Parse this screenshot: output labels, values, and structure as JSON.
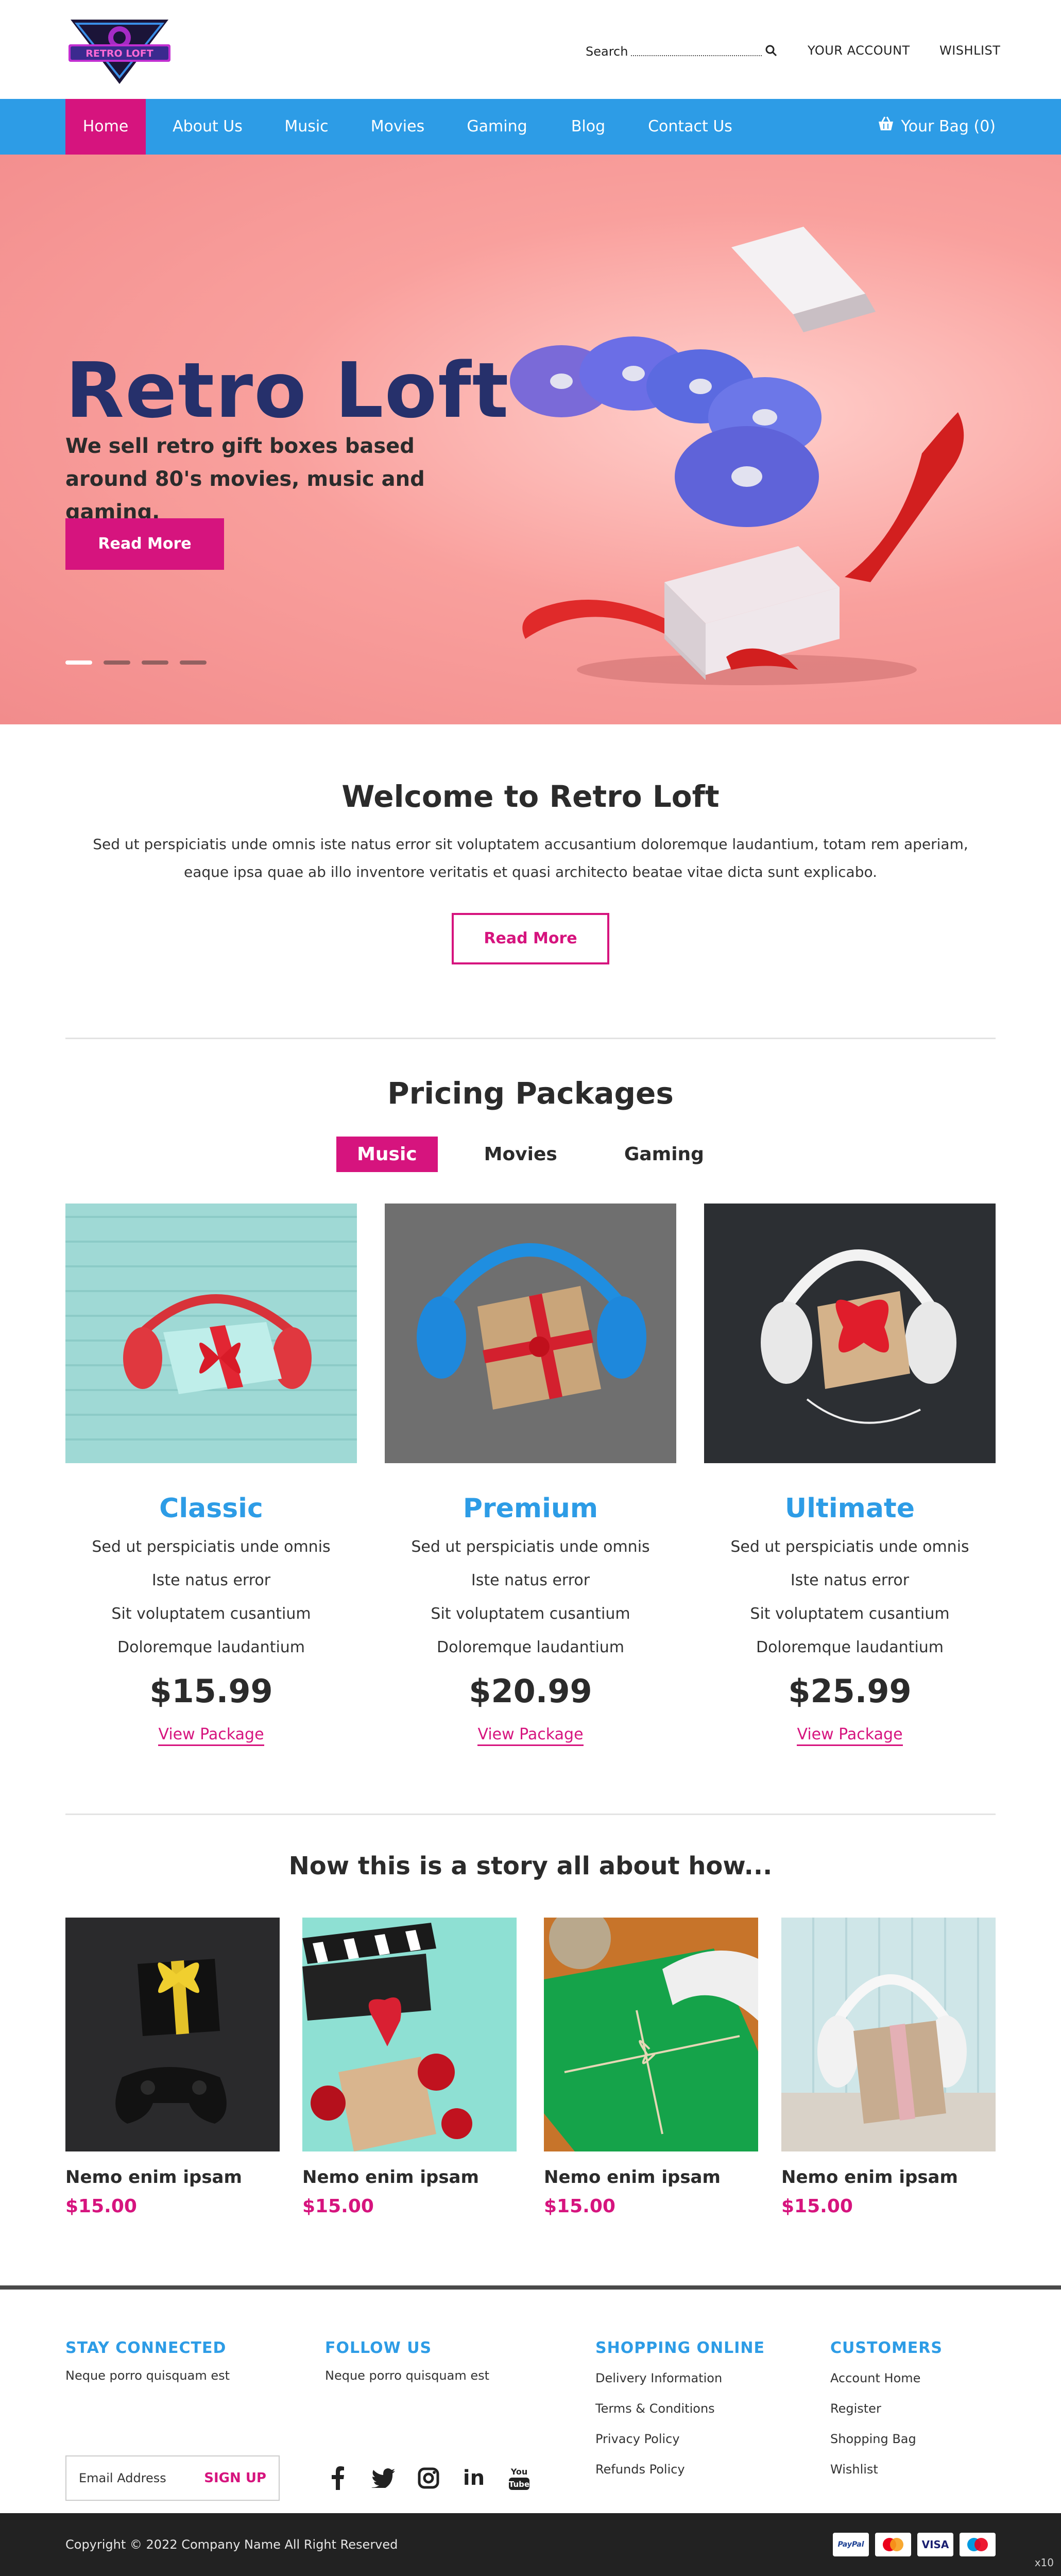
{
  "header": {
    "logo_text": "RETRO LOFT",
    "search_label": "Search",
    "account_label": "YOUR ACCOUNT",
    "wishlist_label": "WISHLIST"
  },
  "nav": {
    "items": [
      {
        "label": "Home",
        "active": true
      },
      {
        "label": "About Us"
      },
      {
        "label": "Music"
      },
      {
        "label": "Movies"
      },
      {
        "label": "Gaming"
      },
      {
        "label": "Blog"
      },
      {
        "label": "Contact Us"
      }
    ],
    "bag_label": "Your Bag (0)"
  },
  "hero": {
    "title": "Retro Loft",
    "subtitle": "We sell retro gift boxes based around 80's movies, music and gaming.",
    "button": "Read More",
    "slides": 4,
    "active_slide": 1
  },
  "welcome": {
    "title": "Welcome to Retro Loft",
    "text": "Sed ut perspiciatis unde omnis iste natus error sit voluptatem accusantium doloremque laudantium, totam rem aperiam, eaque ipsa quae ab illo inventore veritatis et quasi architecto beatae vitae dicta sunt explicabo.",
    "button": "Read More"
  },
  "pricing": {
    "title": "Pricing Packages",
    "tabs": [
      {
        "label": "Music",
        "active": true
      },
      {
        "label": "Movies"
      },
      {
        "label": "Gaming"
      }
    ],
    "packages": [
      {
        "name": "Classic",
        "lines": [
          "Sed ut perspiciatis unde omnis",
          "Iste natus error",
          "Sit voluptatem cusantium",
          "Doloremque laudantium"
        ],
        "price": "$15.99",
        "link": "View Package"
      },
      {
        "name": "Premium",
        "lines": [
          "Sed ut perspiciatis unde omnis",
          "Iste natus error",
          "Sit voluptatem cusantium",
          "Doloremque laudantium"
        ],
        "price": "$20.99",
        "link": "View Package"
      },
      {
        "name": "Ultimate",
        "lines": [
          "Sed ut perspiciatis unde omnis",
          "Iste natus error",
          "Sit voluptatem cusantium",
          "Doloremque laudantium"
        ],
        "price": "$25.99",
        "link": "View Package"
      }
    ]
  },
  "story": {
    "title": "Now this is a story all about how...",
    "products": [
      {
        "name": "Nemo enim ipsam",
        "price": "$15.00"
      },
      {
        "name": "Nemo enim ipsam",
        "price": "$15.00"
      },
      {
        "name": "Nemo enim ipsam",
        "price": "$15.00"
      },
      {
        "name": "Nemo enim ipsam",
        "price": "$15.00"
      }
    ]
  },
  "footer": {
    "stay": {
      "title": "STAY CONNECTED",
      "text": "Neque porro quisquam est",
      "email_placeholder": "Email Address",
      "signup": "SIGN UP"
    },
    "follow": {
      "title": "FOLLOW US",
      "text": "Neque porro quisquam est",
      "icons": [
        "facebook-icon",
        "twitter-icon",
        "instagram-icon",
        "linkedin-icon",
        "youtube-icon"
      ],
      "youtube_text": "You Tube",
      "linkedin_text": "in"
    },
    "shopping": {
      "title": "SHOPPING ONLINE",
      "links": [
        "Delivery Information",
        "Terms & Conditions",
        "Privacy Policy",
        "Refunds Policy"
      ]
    },
    "customers": {
      "title": "CUSTOMERS",
      "links": [
        "Account Home",
        "Register",
        "Shopping Bag",
        "Wishlist"
      ]
    },
    "copyright": "Copyright © 2022 Company Name All Right Reserved",
    "payments": [
      "PayPal",
      "",
      "VISA",
      ""
    ],
    "corner_text": "x10"
  },
  "colors": {
    "accent": "#d6147e",
    "nav": "#2d9ce6",
    "hero_title": "#26306b",
    "footer_dark": "#222222"
  }
}
